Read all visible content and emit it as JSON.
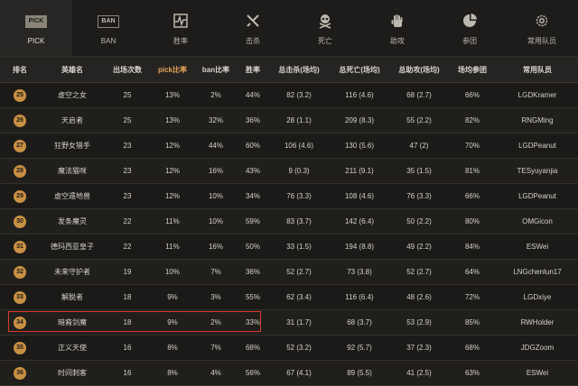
{
  "tabs": [
    {
      "label": "PICK",
      "badge": "PICK",
      "icon": "pick-badge-icon",
      "active": true
    },
    {
      "label": "BAN",
      "badge": "BAN",
      "icon": "ban-badge-icon",
      "active": false
    },
    {
      "label": "胜率",
      "icon": "winrate-chart-icon",
      "active": false
    },
    {
      "label": "击杀",
      "icon": "crossed-swords-icon",
      "active": false
    },
    {
      "label": "死亡",
      "icon": "skull-icon",
      "active": false
    },
    {
      "label": "助攻",
      "icon": "hand-icon",
      "active": false
    },
    {
      "label": "参团",
      "icon": "pie-chart-icon",
      "active": false
    },
    {
      "label": "常用队员",
      "icon": "gear-icon",
      "active": false
    }
  ],
  "table": {
    "headers": [
      "排名",
      "英雄名",
      "出场次数",
      "pick比率",
      "ban比率",
      "胜率",
      "总击杀(场均)",
      "总死亡(场均)",
      "总助攻(场均)",
      "场均参团",
      "常用队员"
    ],
    "rows": [
      [
        "25",
        "虚空之女",
        "25",
        "13%",
        "2%",
        "44%",
        "82 (3.2)",
        "116 (4.6)",
        "68 (2.7)",
        "66%",
        "LGDKramer"
      ],
      [
        "26",
        "天启者",
        "25",
        "13%",
        "32%",
        "36%",
        "28 (1.1)",
        "209 (8.3)",
        "55 (2.2)",
        "82%",
        "RNGMing"
      ],
      [
        "27",
        "狂野女猎手",
        "23",
        "12%",
        "44%",
        "60%",
        "106 (4.6)",
        "130 (5.6)",
        "47 (2)",
        "70%",
        "LGDPeanut"
      ],
      [
        "28",
        "魔法猫咪",
        "23",
        "12%",
        "16%",
        "43%",
        "9 (0.3)",
        "211 (9.1)",
        "35 (1.5)",
        "81%",
        "TESyuyanjia"
      ],
      [
        "29",
        "虚空遁地兽",
        "23",
        "12%",
        "10%",
        "34%",
        "76 (3.3)",
        "108 (4.6)",
        "76 (3.3)",
        "66%",
        "LGDPeanut"
      ],
      [
        "30",
        "发条魔灵",
        "22",
        "11%",
        "10%",
        "59%",
        "83 (3.7)",
        "142 (6.4)",
        "50 (2.2)",
        "80%",
        "OMGicon"
      ],
      [
        "31",
        "德玛西亚皇子",
        "22",
        "11%",
        "16%",
        "50%",
        "33 (1.5)",
        "194 (8.8)",
        "49 (2.2)",
        "84%",
        "ESWei"
      ],
      [
        "32",
        "未来守护者",
        "19",
        "10%",
        "7%",
        "36%",
        "52 (2.7)",
        "73 (3.8)",
        "52 (2.7)",
        "64%",
        "LNGchenlun17"
      ],
      [
        "33",
        "解脱者",
        "18",
        "9%",
        "3%",
        "55%",
        "62 (3.4)",
        "116 (6.4)",
        "48 (2.6)",
        "72%",
        "LGDxiye"
      ],
      [
        "34",
        "暗裔剑魔",
        "18",
        "9%",
        "2%",
        "33%",
        "31 (1.7)",
        "68 (3.7)",
        "53 (2.9)",
        "85%",
        "RWHolder"
      ],
      [
        "35",
        "正义天使",
        "16",
        "8%",
        "7%",
        "68%",
        "52 (3.2)",
        "92 (5.7)",
        "37 (2.3)",
        "68%",
        "JDGZoom"
      ],
      [
        "36",
        "时间刺客",
        "16",
        "8%",
        "4%",
        "56%",
        "67 (4.1)",
        "89 (5.5)",
        "41 (2.5)",
        "63%",
        "ESWei"
      ]
    ]
  },
  "colors": {
    "accent": "#e6a65a",
    "rank_badge": "#c89043",
    "highlight_border": "#d93a2b"
  }
}
